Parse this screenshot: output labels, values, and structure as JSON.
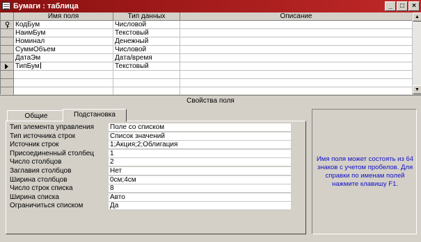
{
  "window": {
    "title": "Бумаги : таблица",
    "minimize": "_",
    "maximize": "□",
    "close": "×"
  },
  "grid": {
    "columns": [
      "Имя поля",
      "Тип данных",
      "Описание"
    ],
    "rows": [
      {
        "name": "КодБум",
        "type": "Числовой",
        "description": ""
      },
      {
        "name": "НаимБум",
        "type": "Текстовый",
        "description": ""
      },
      {
        "name": "Номинал",
        "type": "Денежный",
        "description": ""
      },
      {
        "name": "СуммОбъем",
        "type": "Числовой",
        "description": ""
      },
      {
        "name": "ДатаЭм",
        "type": "Дата/время",
        "description": ""
      },
      {
        "name": "ТипБум",
        "type": "Текстовый",
        "description": ""
      }
    ],
    "key_row_index": 0,
    "current_row_index": 5
  },
  "properties": {
    "caption": "Свойства поля",
    "tabs": [
      {
        "label": "Общие",
        "active": false
      },
      {
        "label": "Подстановка",
        "active": true
      }
    ],
    "items": [
      {
        "label": "Тип элемента управления",
        "value": "Поле со списком"
      },
      {
        "label": "Тип источника строк",
        "value": "Список значений"
      },
      {
        "label": "Источник строк",
        "value": "1;Акция;2;Облигация"
      },
      {
        "label": "Присоединенный столбец",
        "value": "1"
      },
      {
        "label": "Число столбцов",
        "value": "2"
      },
      {
        "label": "Заглавия столбцов",
        "value": "Нет"
      },
      {
        "label": "Ширина столбцов",
        "value": "0см;4см"
      },
      {
        "label": "Число строк списка",
        "value": "8"
      },
      {
        "label": "Ширина списка",
        "value": "Авто"
      },
      {
        "label": "Ограничиться списком",
        "value": "Да"
      }
    ],
    "help_text": "Имя поля может состоять из 64 знаков с учетом пробелов. Для справки по именам полей нажмите клавишу F1."
  },
  "colors": {
    "titlebar": "#8a1010",
    "help_text": "#1010c8",
    "chrome": "#d4d0c8"
  }
}
